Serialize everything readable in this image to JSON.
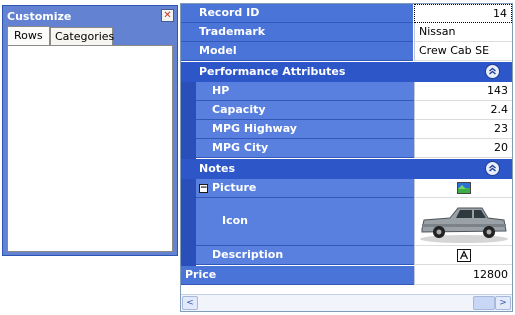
{
  "customize": {
    "title": "Customize",
    "close_glyph": "✕",
    "tabs": [
      {
        "label": "Rows"
      },
      {
        "label": "Categories"
      }
    ]
  },
  "grid": {
    "record_id": {
      "label": "Record ID",
      "value": "14"
    },
    "trademark": {
      "label": "Trademark",
      "value": "Nissan"
    },
    "model": {
      "label": "Model",
      "value": "Crew Cab SE"
    },
    "performance": {
      "label": "Performance Attributes",
      "rows": [
        {
          "label": "HP",
          "value": "143"
        },
        {
          "label": "Capacity",
          "value": "2.4"
        },
        {
          "label": "MPG Highway",
          "value": "23"
        },
        {
          "label": "MPG City",
          "value": "20"
        }
      ]
    },
    "notes": {
      "label": "Notes",
      "picture": {
        "label": "Picture",
        "expander": "−"
      },
      "icon": {
        "label": "Icon"
      },
      "description": {
        "label": "Description"
      }
    },
    "price": {
      "label": "Price",
      "value": "12800"
    }
  },
  "scrollbar": {
    "left_arrow": "<",
    "right_arrow": ">"
  },
  "icons": [
    "close-icon",
    "collapse-chevrons-icon",
    "picture-icon",
    "truck-photo",
    "text-editor-icon",
    "scroll-left-icon",
    "scroll-right-icon"
  ],
  "colors": {
    "caption_blue": "#4b74d8",
    "category_blue": "#2d56c8",
    "panel_blue": "#6482d2"
  }
}
